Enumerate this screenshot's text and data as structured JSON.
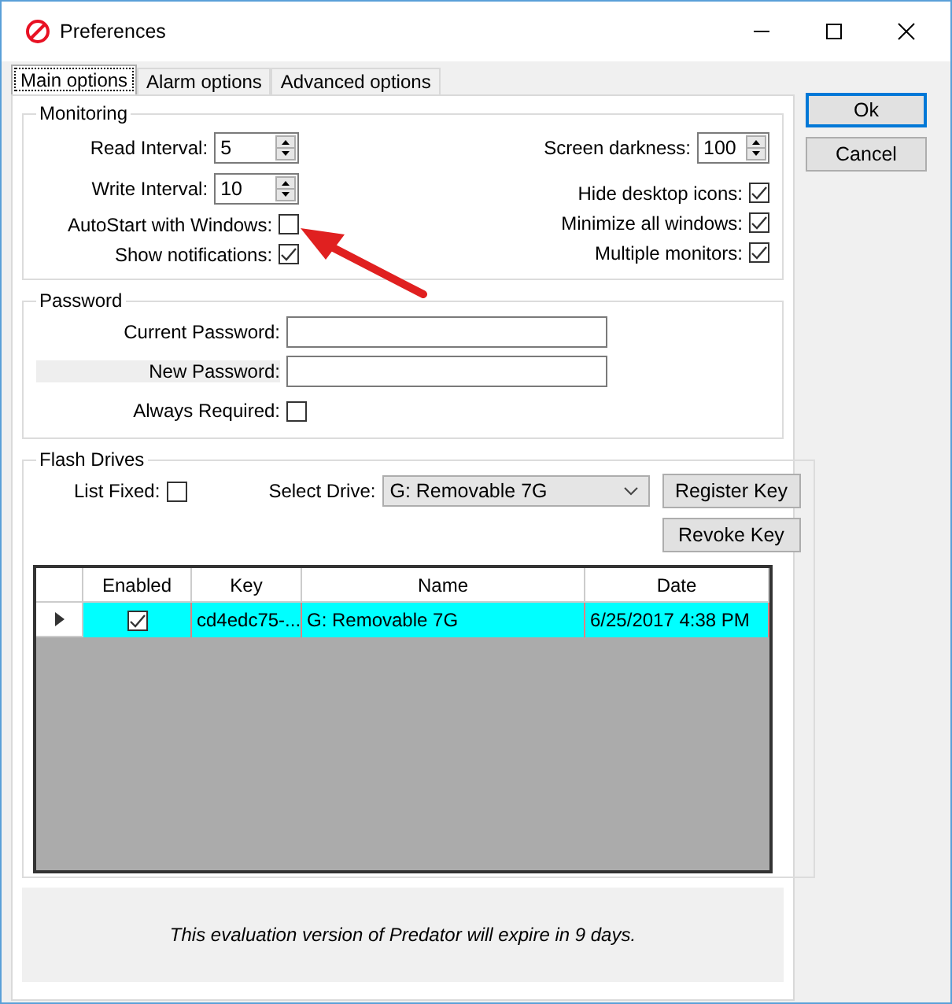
{
  "window": {
    "title": "Preferences"
  },
  "tabs": [
    {
      "label": "Main options",
      "selected": true
    },
    {
      "label": "Alarm options",
      "selected": false
    },
    {
      "label": "Advanced options",
      "selected": false
    }
  ],
  "monitoring": {
    "title": "Monitoring",
    "left": [
      {
        "kind": "spinner",
        "label": "Read Interval:",
        "value": "5"
      },
      {
        "kind": "spinner",
        "label": "Write Interval:",
        "value": "10"
      },
      {
        "kind": "checkbox",
        "label": "AutoStart with Windows:",
        "checked": false
      },
      {
        "kind": "checkbox",
        "label": "Show notifications:",
        "checked": true
      }
    ],
    "right": [
      {
        "kind": "spinner",
        "label": "Screen darkness:",
        "value": "100"
      },
      {
        "kind": "checkbox",
        "label": "Hide desktop icons:",
        "checked": true
      },
      {
        "kind": "checkbox",
        "label": "Minimize all windows:",
        "checked": true
      },
      {
        "kind": "checkbox",
        "label": "Multiple monitors:",
        "checked": true
      }
    ]
  },
  "password": {
    "title": "Password",
    "current_label": "Current Password:",
    "new_label": "New Password:",
    "always_label": "Always Required:",
    "always_checked": false
  },
  "flash_drives": {
    "title": "Flash Drives",
    "list_fixed_label": "List Fixed:",
    "list_fixed_checked": false,
    "select_label": "Select Drive:",
    "selected_drive": "G: Removable 7G",
    "register_button": "Register Key",
    "revoke_button": "Revoke Key",
    "table": {
      "columns": [
        "Enabled",
        "Key",
        "Name",
        "Date"
      ],
      "rows": [
        {
          "enabled": true,
          "key": "cd4edc75-...",
          "name": "G: Removable 7G",
          "date": "6/25/2017 4:38 PM",
          "selected": true
        }
      ]
    }
  },
  "footer": "This evaluation version of Predator will expire in 9 days.",
  "buttons": [
    "Ok",
    "Cancel"
  ]
}
